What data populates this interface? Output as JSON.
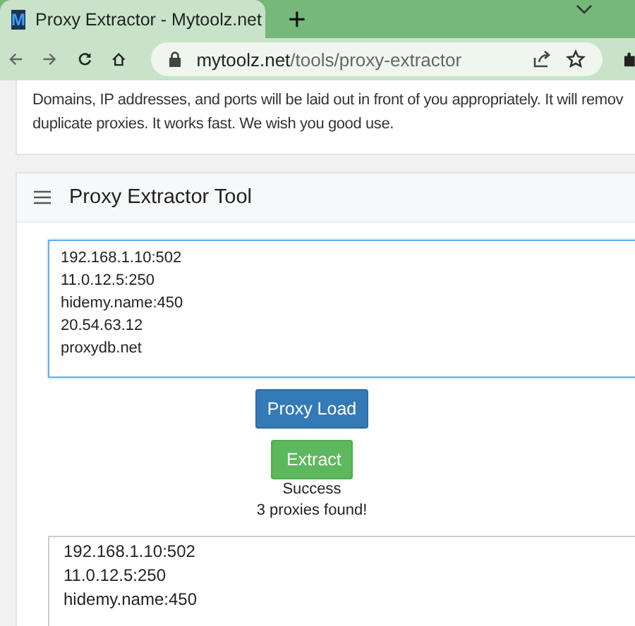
{
  "browser": {
    "tab": {
      "title": "Proxy Extractor - Mytoolz.net",
      "logo": "M",
      "selected": true
    },
    "new_tab": "+",
    "url": {
      "domain": "mytoolz.net",
      "path": "/tools/proxy-extractor"
    }
  },
  "intro": {
    "lines": [
      "Domains, IP addresses, and ports will be laid out in front of you appropriately. It will remov",
      "duplicate proxies. It works fast. We wish you good use."
    ]
  },
  "tool": {
    "title": "Proxy Extractor Tool",
    "input": {
      "lines": [
        "192.168.1.10:502",
        "11.0.12.5:250",
        "hidemy.name:450",
        "20.54.63.12",
        "proxydb.net"
      ],
      "focused": true
    },
    "buttons": [
      {
        "label": "Proxy Load",
        "kind": "primary"
      },
      {
        "label": "Extract",
        "kind": "success"
      }
    ],
    "status": "Success",
    "count": "3 proxies found!",
    "output": {
      "lines": [
        "192.168.1.10:502",
        "11.0.12.5:250",
        "hidemy.name:450"
      ]
    }
  }
}
